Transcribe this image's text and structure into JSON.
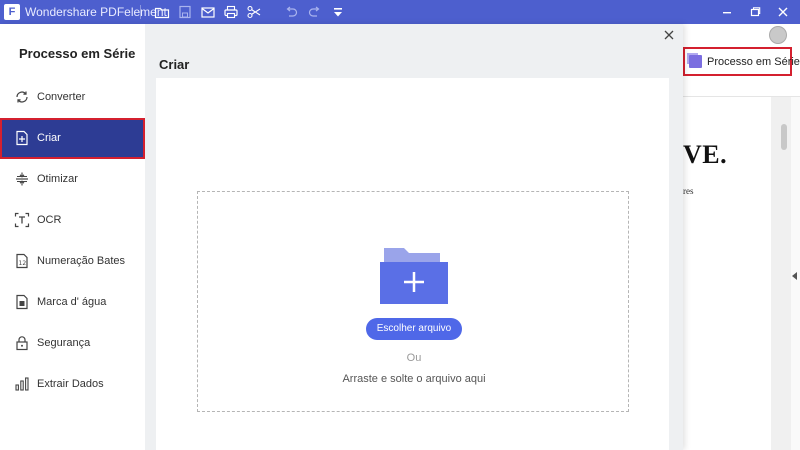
{
  "titlebar": {
    "app_title": "Wondershare PDFelement",
    "logo_letter": "F",
    "icons": [
      "folder-open-icon",
      "save-icon",
      "mail-icon",
      "print-icon",
      "scissors-icon",
      "undo-icon",
      "redo-icon",
      "quick-access-dropdown-icon"
    ],
    "window_controls": [
      "minimize-icon",
      "restore-icon",
      "close-icon"
    ],
    "bg_color": "#4d5fce"
  },
  "background_app": {
    "batch_button_label": "Processo em Série",
    "doc_heading": "VE.",
    "doc_small_text": "res"
  },
  "dialog": {
    "sidebar_title": "Processo em Série",
    "items": [
      {
        "label": "Converter",
        "icon": "refresh-icon"
      },
      {
        "label": "Criar",
        "icon": "file-plus-icon",
        "active": true
      },
      {
        "label": "Otimizar",
        "icon": "compress-icon"
      },
      {
        "label": "OCR",
        "icon": "ocr-icon"
      },
      {
        "label": "Numeração Bates",
        "icon": "bates-number-icon"
      },
      {
        "label": "Marca d' água",
        "icon": "watermark-icon"
      },
      {
        "label": "Segurança",
        "icon": "lock-icon"
      },
      {
        "label": "Extrair Dados",
        "icon": "bar-chart-icon"
      }
    ],
    "main_title": "Criar",
    "choose_file_label": "Escolher arquivo",
    "or_label": "Ou",
    "drag_label": "Arraste e solte o arquivo aqui",
    "accent_color": "#4f68e8",
    "active_bg": "#2d3c94",
    "highlight_color": "#d4202f"
  }
}
